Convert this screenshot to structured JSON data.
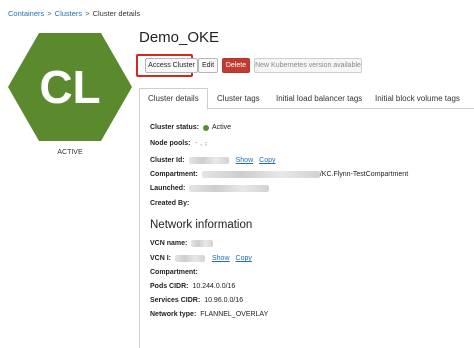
{
  "breadcrumb": {
    "root": "Containers",
    "parent": "Clusters",
    "current": "Cluster details",
    "separator": ">"
  },
  "cluster": {
    "initials": "CL",
    "state": "ACTIVE",
    "name": "Demo_OKE",
    "hex_color": "#5b8a2e"
  },
  "actions": {
    "access": "Access Cluster",
    "edit": "Edit",
    "delete": "Delete",
    "k8s": "New Kubernetes version available"
  },
  "tabs": [
    "Cluster details",
    "Cluster tags",
    "Initial load balancer tags",
    "Initial block volume tags"
  ],
  "details": {
    "status_label": "Cluster status:",
    "status_value": "Active",
    "status_color": "#5d8c2c",
    "node_pools_label": "Node pools:",
    "cluster_id_label": "Cluster Id:",
    "show": "Show",
    "copy": "Copy",
    "compartment_label": "Compartment:",
    "compartment_value": "/KC.Flynn-TestCompartment",
    "launched_label": "Launched:",
    "created_by_label": "Created By:"
  },
  "network": {
    "title": "Network information",
    "vcn_name_label": "VCN name:",
    "vcn_id_label": "VCN I:",
    "show": "Show",
    "copy": "Copy",
    "compartment_label": "Compartment:",
    "pods_cidr_label": "Pods CIDR:",
    "pods_cidr_value": "10.244.0.0/16",
    "services_cidr_label": "Services CIDR:",
    "services_cidr_value": "10.96.0.0/16",
    "network_type_label": "Network type:",
    "network_type_value": "FLANNEL_OVERLAY"
  }
}
